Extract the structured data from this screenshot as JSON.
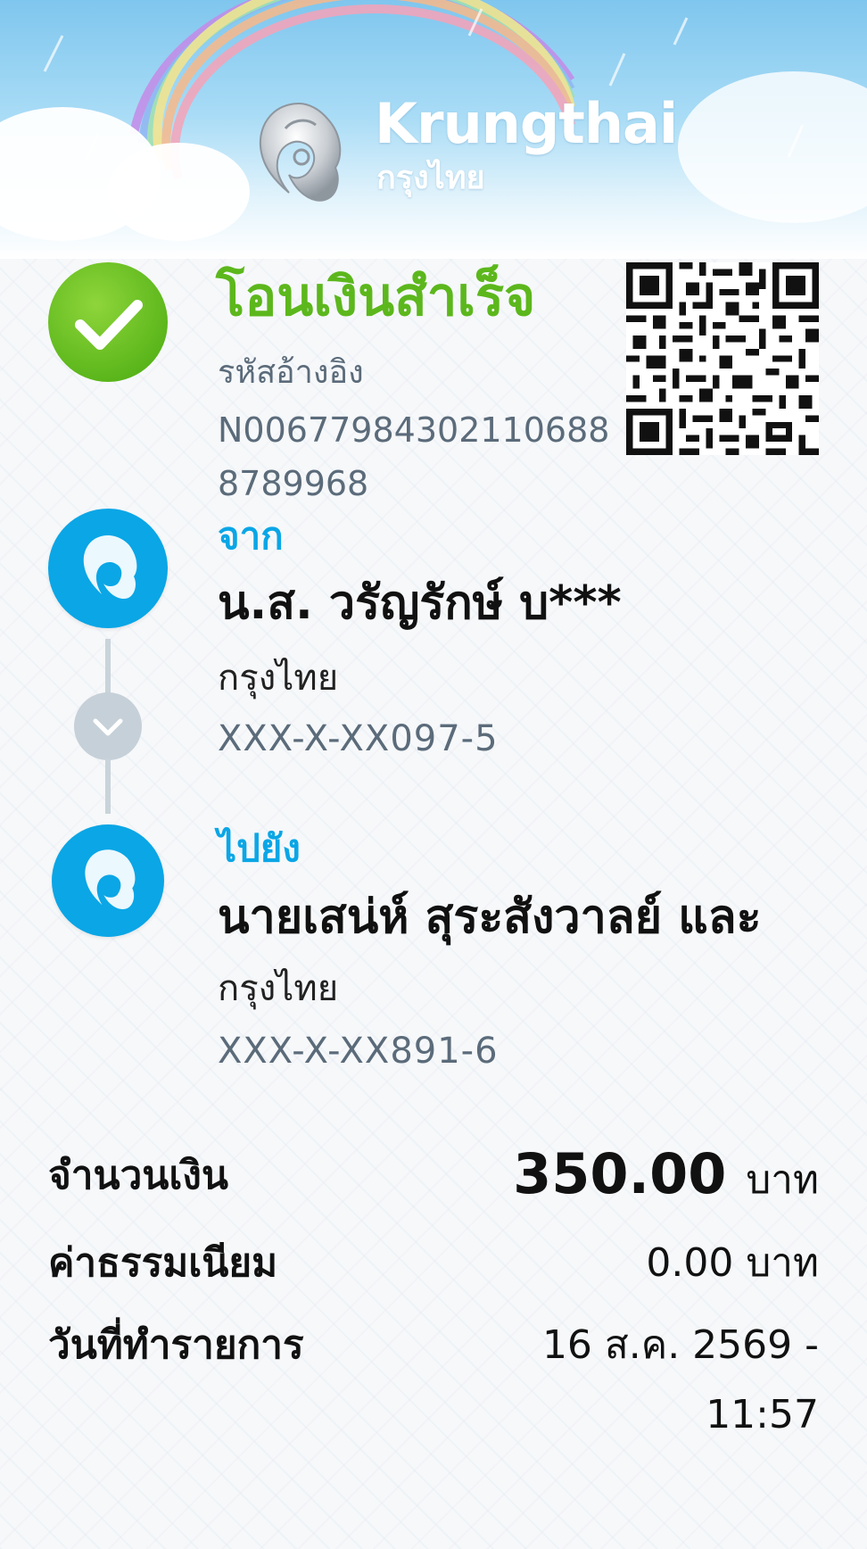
{
  "brand": {
    "name": "Krungthai",
    "name_thai": "กรุงไทย"
  },
  "status": {
    "title": "โอนเงินสำเร็จ",
    "ref_label": "รหัสอ้างอิง",
    "ref_value": "N006779843021106888789968",
    "icon": "check-icon",
    "color": "#5cb71c"
  },
  "from": {
    "label": "จาก",
    "name": "น.ส. วรัญรักษ์ บ***",
    "bank": "กรุงไทย",
    "account": "XXX-X-XX097-5"
  },
  "to": {
    "label": "ไปยัง",
    "name": "นายเสน่ห์ สุระสังวาลย์ และ",
    "bank": "กรุงไทย",
    "account": "XXX-X-XX891-6"
  },
  "summary": {
    "amount_label": "จำนวนเงิน",
    "amount_value": "350.00",
    "amount_unit": "บาท",
    "fee_label": "ค่าธรรมเนียม",
    "fee_value": "0.00 บาท",
    "date_label": "วันที่ทำรายการ",
    "date_value": "16 ส.ค. 2569 -",
    "time_value": "11:57"
  },
  "colors": {
    "accent_blue": "#0aa6e6",
    "success_green": "#5cb71c",
    "muted_text": "#5b6b7a"
  }
}
